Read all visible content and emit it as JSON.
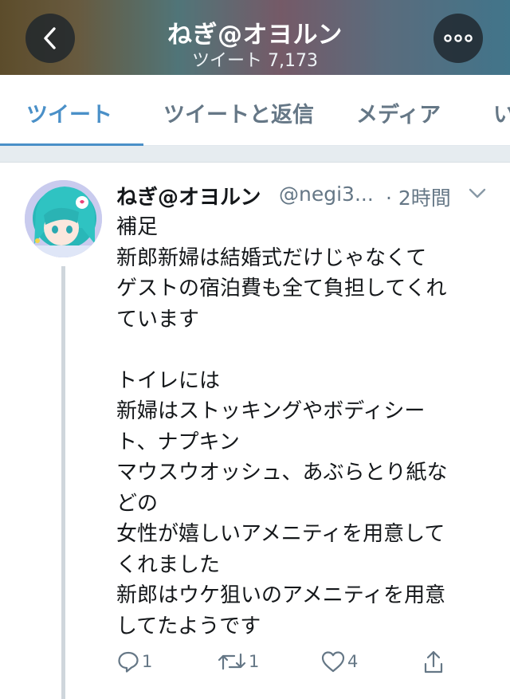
{
  "header": {
    "title": "ねぎ@オヨルン",
    "subtitle": "ツイート 7,173",
    "back_icon": "chevron-left-icon",
    "more_icon": "more-dots-icon"
  },
  "tabs": [
    {
      "label": "ツイート",
      "active": true
    },
    {
      "label": "ツイートと返信",
      "active": false
    },
    {
      "label": "メディア",
      "active": false
    },
    {
      "label": "い",
      "active": false
    }
  ],
  "tweet": {
    "author_name": "ねぎ@オヨルン",
    "handle": "@negi3...",
    "time": "· 2時間",
    "lines": [
      "補足",
      "新郎新婦は結婚式だけじゃなくて",
      "ゲストの宿泊費も全て負担してくれ",
      "ています",
      "",
      "トイレには",
      "新婦はストッキングやボディシー",
      "ト、ナプキン",
      "マウスウオッシュ、あぶらとり紙な",
      "どの",
      "女性が嬉しいアメニティを用意して",
      "くれました",
      "新郎はウケ狙いのアメニティを用意",
      "してたようです"
    ],
    "actions": {
      "reply_count": "1",
      "retweet_count": "1",
      "like_count": "4"
    }
  },
  "colors": {
    "accent": "#4a90c8",
    "secondary_text": "#657786",
    "primary_text": "#14171a"
  }
}
